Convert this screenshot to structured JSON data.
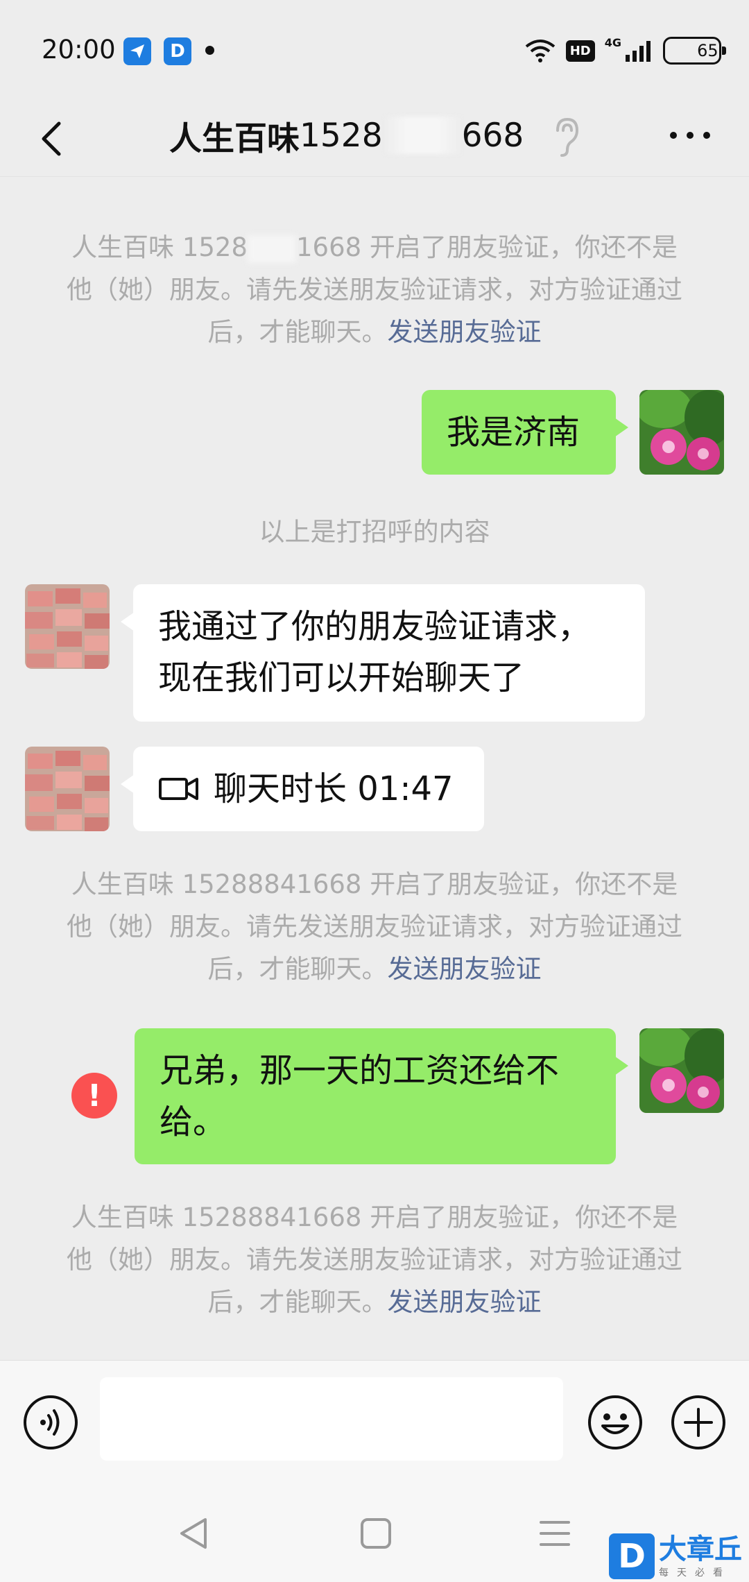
{
  "status_bar": {
    "time": "20:00",
    "app_icon_1": "paper-plane-app-icon",
    "app_icon_2": "D",
    "hd": "HD",
    "network": "4G",
    "battery": "65",
    "battery_level": 0.65
  },
  "header": {
    "title_name": "人生百味",
    "title_number_start": "1528",
    "title_number_end": "668"
  },
  "messages": {
    "notice_1": {
      "text_a": "人生百味 1528",
      "text_b": "1668 开启了朋友验证，你还不是他（她）朋友。请先发送朋友验证请求，对方验证通过后，才能聊天。",
      "link": "发送朋友验证"
    },
    "sent_1": "我是济南",
    "greeting_tip": "以上是打招呼的内容",
    "received_1": "我通过了你的朋友验证请求，现在我们可以开始聊天了",
    "call_duration": "聊天时长 01:47",
    "notice_2": {
      "text": "人生百味 15288841668 开启了朋友验证，你还不是他（她）朋友。请先发送朋友验证请求，对方验证通过后，才能聊天。",
      "link": "发送朋友验证"
    },
    "sent_2": "兄弟，那一天的工资还给不给。",
    "error_mark": "!",
    "notice_3": {
      "text": "人生百味 15288841668 开启了朋友验证，你还不是他（她）朋友。请先发送朋友验证请求，对方验证通过后，才能聊天。",
      "link": "发送朋友验证"
    }
  },
  "input": {
    "value": "",
    "placeholder": ""
  },
  "watermark": {
    "logo": "D",
    "main": "大章丘",
    "sub": "每天必看"
  },
  "colors": {
    "sent_bubble": "#95ec69",
    "received_bubble": "#ffffff",
    "link": "#576b95",
    "error": "#fa5151",
    "background": "#ededed"
  }
}
